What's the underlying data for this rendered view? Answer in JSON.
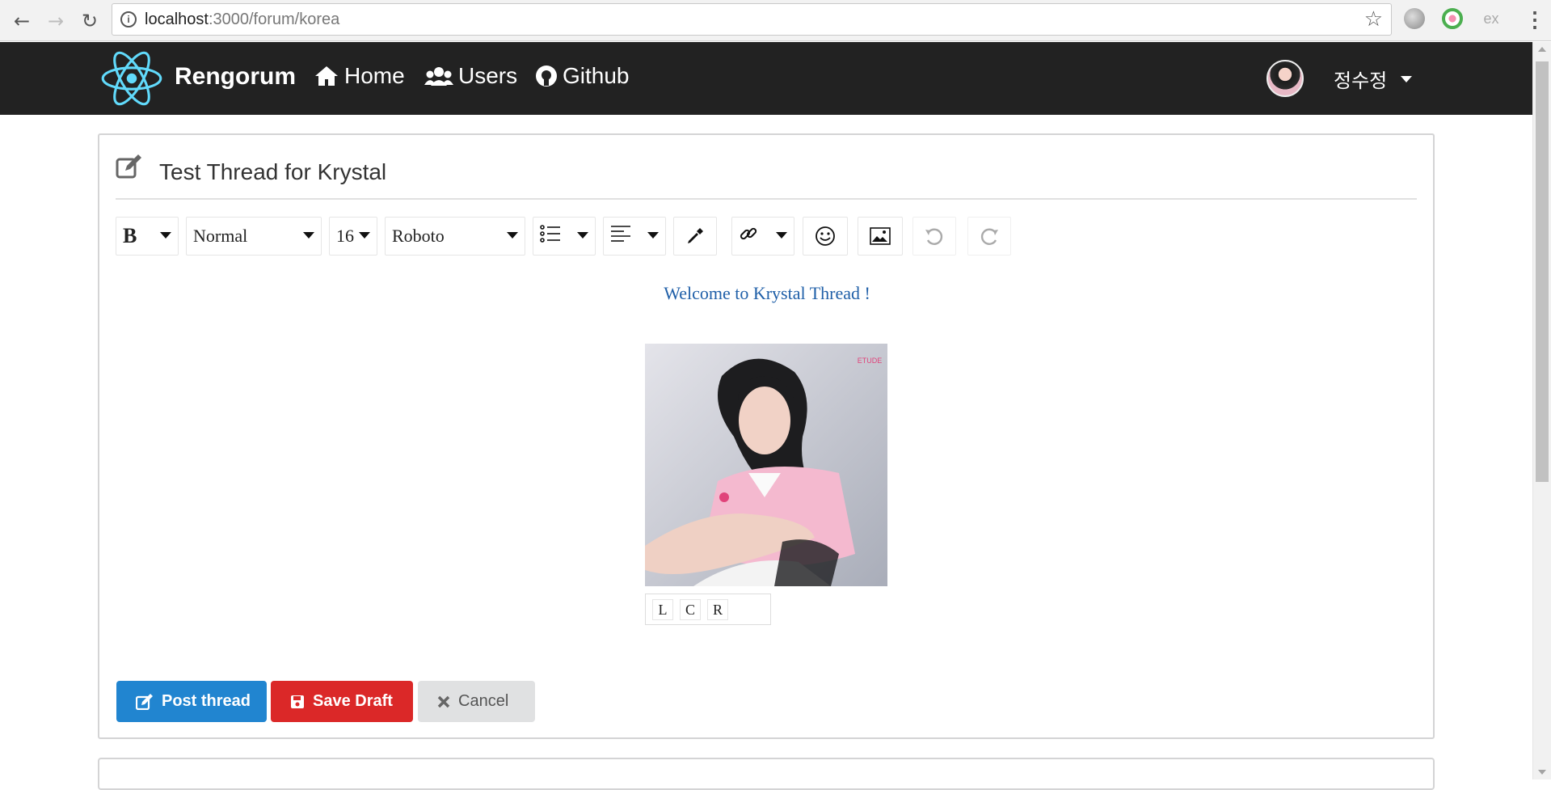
{
  "browser": {
    "url_host": "localhost",
    "url_path": ":3000/forum/korea",
    "back_icon": "back-arrow-icon",
    "forward_icon": "forward-arrow-icon",
    "reload_icon": "reload-icon",
    "ext3_label": "ex"
  },
  "navbar": {
    "brand": "Rengorum",
    "links": [
      {
        "label": "Home",
        "icon": "home-icon"
      },
      {
        "label": "Users",
        "icon": "users-icon"
      },
      {
        "label": "Github",
        "icon": "github-icon"
      }
    ],
    "username": "정수정"
  },
  "editor": {
    "thread_title": "Test Thread for Krystal",
    "toolbar": {
      "bold": "B",
      "block_type": "Normal",
      "font_size": "16",
      "font_family": "Roboto"
    },
    "body_text": "Welcome to Krystal Thread !",
    "image_align": [
      "L",
      "C",
      "R"
    ]
  },
  "actions": {
    "post": "Post thread",
    "save": "Save Draft",
    "cancel": "Cancel"
  },
  "colors": {
    "navbar": "#222222",
    "post": "#2185d0",
    "save": "#db2828",
    "cancel": "#e0e1e2",
    "body_text": "#1f5fa8"
  }
}
